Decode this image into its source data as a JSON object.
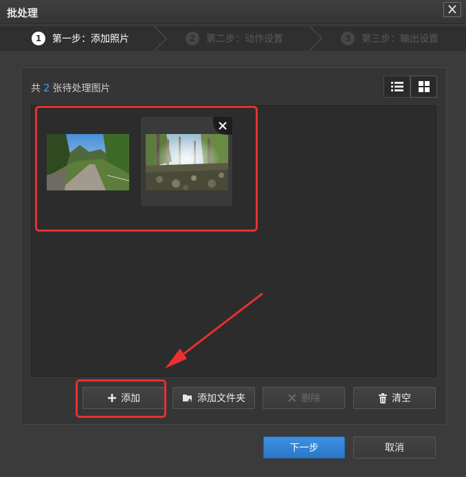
{
  "window": {
    "title": "批处理"
  },
  "steps": [
    {
      "num": "1",
      "label": "第一步：添加照片",
      "active": true
    },
    {
      "num": "2",
      "label": "第二步：动作设置",
      "active": false
    },
    {
      "num": "3",
      "label": "第三步：输出设置",
      "active": false
    }
  ],
  "summary": {
    "prefix": "共",
    "count": "2",
    "suffix": "张待处理图片"
  },
  "thumbnails": [
    {
      "name": "mountain-road-photo",
      "description": "mountain road with trees"
    },
    {
      "name": "forest-stream-photo",
      "description": "trees with rocky stream bed"
    }
  ],
  "toolbar": {
    "add": "添加",
    "add_folder": "添加文件夹",
    "delete": "删除",
    "clear": "清空"
  },
  "footer": {
    "next": "下一步",
    "cancel": "取消"
  },
  "colors": {
    "accent": "#4a9eea",
    "highlight": "#e83030",
    "primary_button": "#2f80d2"
  }
}
